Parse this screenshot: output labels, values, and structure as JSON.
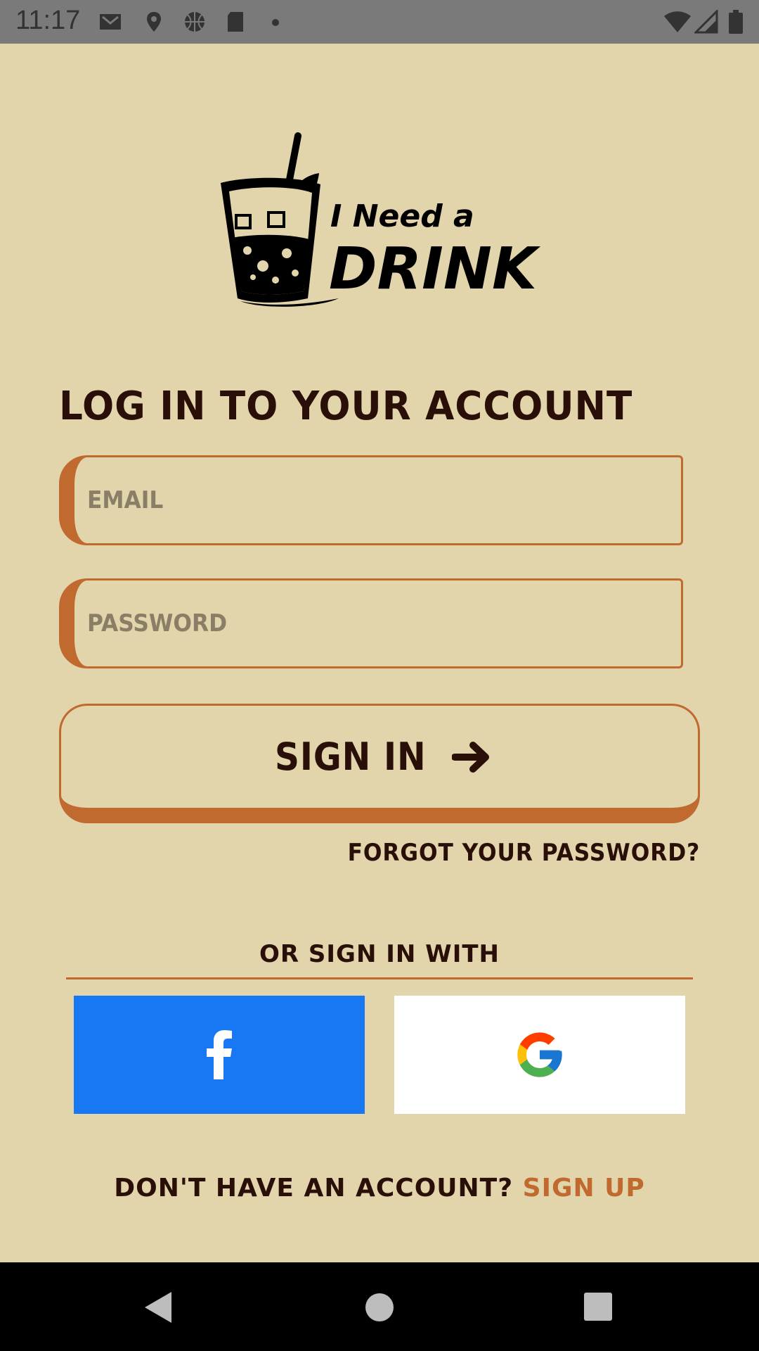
{
  "status_bar": {
    "time": "11:17"
  },
  "logo": {
    "line1": "I Need a",
    "line2": "DRINK"
  },
  "login": {
    "title": "LOG IN TO YOUR ACCOUNT",
    "email_placeholder": "EMAIL",
    "password_placeholder": "PASSWORD",
    "email_value": "",
    "password_value": "",
    "sign_in_label": "SIGN IN",
    "forgot_password": "FORGOT YOUR PASSWORD?",
    "or_sign_in_with": "OR SIGN IN WITH"
  },
  "social": {
    "facebook_color": "#1877f2",
    "google_color": "#ffffff"
  },
  "signup": {
    "prompt": "DON'T HAVE AN ACCOUNT?",
    "link": "SIGN UP"
  },
  "colors": {
    "background": "#e2d4ab",
    "accent": "#c06a30",
    "text": "#2a0f08"
  }
}
